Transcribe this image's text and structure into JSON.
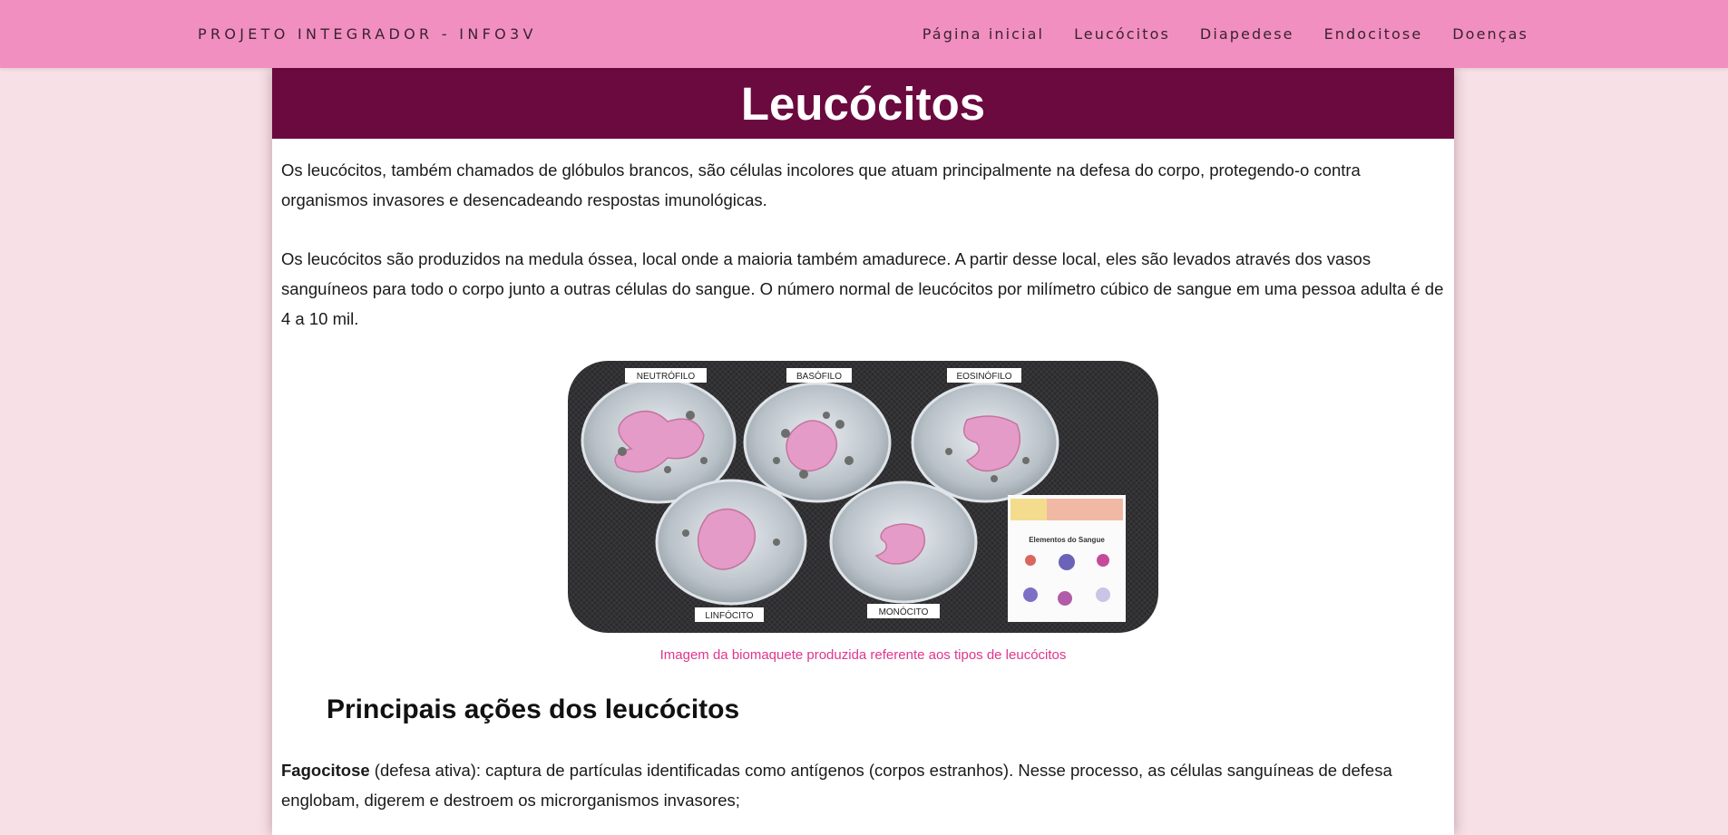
{
  "nav": {
    "brand": "PROJETO INTEGRADOR - INFO3V",
    "links": [
      "Página inicial",
      "Leucócitos",
      "Diapedese",
      "Endocitose",
      "Doenças"
    ]
  },
  "page": {
    "title": "Leucócitos",
    "paragraph1": "Os leucócitos, também chamados de glóbulos brancos, são células incolores que atuam principalmente na defesa do corpo, protegendo-o contra organismos invasores e desencadeando respostas imunológicas.",
    "paragraph2": "Os leucócitos são produzidos na medula óssea, local onde a maioria também amadurece. A partir desse local, eles são levados através dos vasos sanguíneos para todo o corpo junto a outras células do sangue. O número normal de leucócitos por milímetro cúbico de sangue em uma pessoa adulta é de 4 a 10 mil.",
    "figure": {
      "labels": [
        "NEUTRÓFILO",
        "BASÓFILO",
        "EOSINÓFILO",
        "LINFÓCITO",
        "MONÓCITO"
      ],
      "poster_title": "Elementos do Sangue",
      "caption": "Imagem da biomaquete produzida referente aos tipos de leucócitos"
    },
    "section_title": "Principais ações dos leucócitos",
    "paragraph3_bold": "Fagocitose",
    "paragraph3_rest": " (defesa ativa): captura de partículas identificadas como antígenos (corpos estranhos). Nesse processo, as células sanguíneas de defesa englobam, digerem e destroem os microrganismos invasores;"
  },
  "colors": {
    "navbar": "#f28fc1",
    "page_background": "#f7e1e6",
    "title_bar": "#6b0a3f",
    "caption": "#e0358f"
  }
}
